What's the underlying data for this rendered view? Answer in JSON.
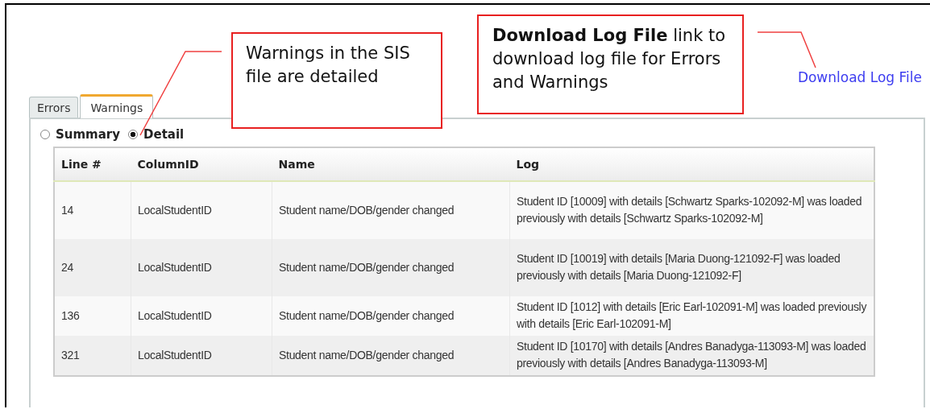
{
  "callouts": [
    {
      "text": "Warnings in the SIS file are detailed"
    },
    {
      "text": "**Download Log File** link to download log file for Errors and Warnings"
    }
  ],
  "download_link": {
    "label": "Download Log File"
  },
  "tabs": [
    {
      "label": "Errors",
      "selected": false
    },
    {
      "label": "Warnings",
      "selected": true
    }
  ],
  "view_options": [
    {
      "label": "Summary",
      "selected": false
    },
    {
      "label": "Detail",
      "selected": true
    }
  ],
  "table": {
    "columns": [
      "Line #",
      "ColumnID",
      "Name",
      "Log"
    ],
    "rows": [
      [
        "14",
        "LocalStudentID",
        "Student name/DOB/gender changed",
        "Student ID [10009] with details [Schwartz Sparks-102092-M] was loaded previously with details [Schwartz Sparks-102092-M]"
      ],
      [
        "24",
        "LocalStudentID",
        "Student name/DOB/gender changed",
        "Student ID [10019] with details [Maria Duong-121092-F] was loaded previously with details [Maria Duong-121092-F]"
      ],
      [
        "136",
        "LocalStudentID",
        "Student name/DOB/gender changed",
        "Student ID [1012] with details [Eric Earl-102091-M] was loaded previously with details [Eric Earl-102091-M]"
      ],
      [
        "321",
        "LocalStudentID",
        "Student name/DOB/gender changed",
        "Student ID [10170] with details [Andres Banadyga-113093-M] was loaded previously with details [Andres Banadyga-113093-M]"
      ]
    ]
  }
}
